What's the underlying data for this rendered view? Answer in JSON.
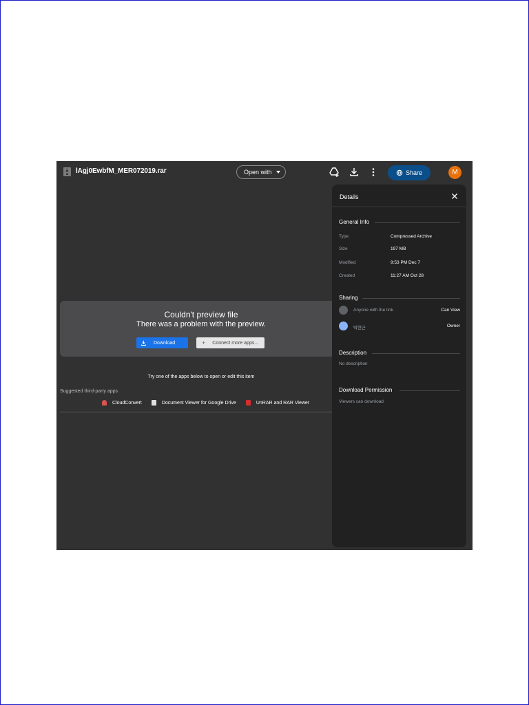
{
  "topbar": {
    "file_name": "lAgj0EwbfM_MER072019.rar",
    "open_with_label": "Open with",
    "share_label": "Share",
    "avatar_letter": "M"
  },
  "preview": {
    "error_title": "Couldn't preview file",
    "error_subtitle": "There was a problem with the preview.",
    "download_label": "Download",
    "connect_label": "Connect more apps...",
    "try_text": "Try one of the apps below to open or edit this item",
    "suggested_label": "Suggested third-party apps",
    "apps": [
      {
        "name": "CloudConvert",
        "color": "#d9534f"
      },
      {
        "name": "Document Viewer for Google Drive",
        "color": "#e0e0e0"
      },
      {
        "name": "UnRAR and RAR Viewer",
        "color": "#d32f2f"
      }
    ]
  },
  "details": {
    "title": "Details",
    "general_info_heading": "General Info",
    "general_info": [
      {
        "label": "Type",
        "value": "Compressed Archive"
      },
      {
        "label": "Size",
        "value": "197 MB"
      },
      {
        "label": "Modified",
        "value": "9:53 PM Dec 7"
      },
      {
        "label": "Created",
        "value": "11:27 AM Oct 28"
      }
    ],
    "sharing_heading": "Sharing",
    "sharing": [
      {
        "who": "Anyone with the link",
        "role": "Can View"
      },
      {
        "who": "박현근",
        "role": "Owner"
      }
    ],
    "description_heading": "Description",
    "description_text": "No description",
    "download_permission_heading": "Download Permission",
    "download_permission_text": "Viewers can download"
  },
  "colors": {
    "background": "#313131",
    "panel": "#212121",
    "accent_blue": "#1a73e8",
    "share_blue": "#0b4f8a",
    "avatar_orange": "#e8710a"
  }
}
